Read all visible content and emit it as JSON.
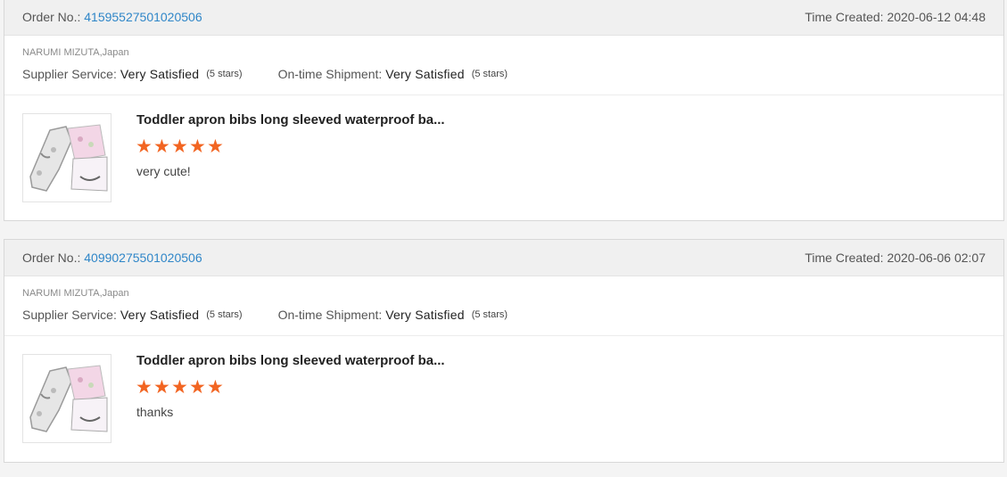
{
  "feedbacks": [
    {
      "order_label": "Order No.:",
      "order_number": "41595527501020506",
      "time_label": "Time Created:",
      "time_value": "2020-06-12 04:48",
      "buyer": "NARUMI MIZUTA,Japan",
      "supplier_label": "Supplier Service:",
      "supplier_value": "Very Satisfied",
      "supplier_stars": "(5 stars)",
      "shipment_label": "On-time Shipment:",
      "shipment_value": "Very Satisfied",
      "shipment_stars": "(5 stars)",
      "product_title": "Toddler apron bibs long sleeved waterproof ba...",
      "rating": 5,
      "comment": "very cute!"
    },
    {
      "order_label": "Order No.:",
      "order_number": "40990275501020506",
      "time_label": "Time Created:",
      "time_value": "2020-06-06 02:07",
      "buyer": "NARUMI MIZUTA,Japan",
      "supplier_label": "Supplier Service:",
      "supplier_value": "Very Satisfied",
      "supplier_stars": "(5 stars)",
      "shipment_label": "On-time Shipment:",
      "shipment_value": "Very Satisfied",
      "shipment_stars": "(5 stars)",
      "product_title": "Toddler apron bibs long sleeved waterproof ba...",
      "rating": 5,
      "comment": "thanks"
    }
  ],
  "colors": {
    "star": "#f26522",
    "order_link": "#2f86c8"
  }
}
